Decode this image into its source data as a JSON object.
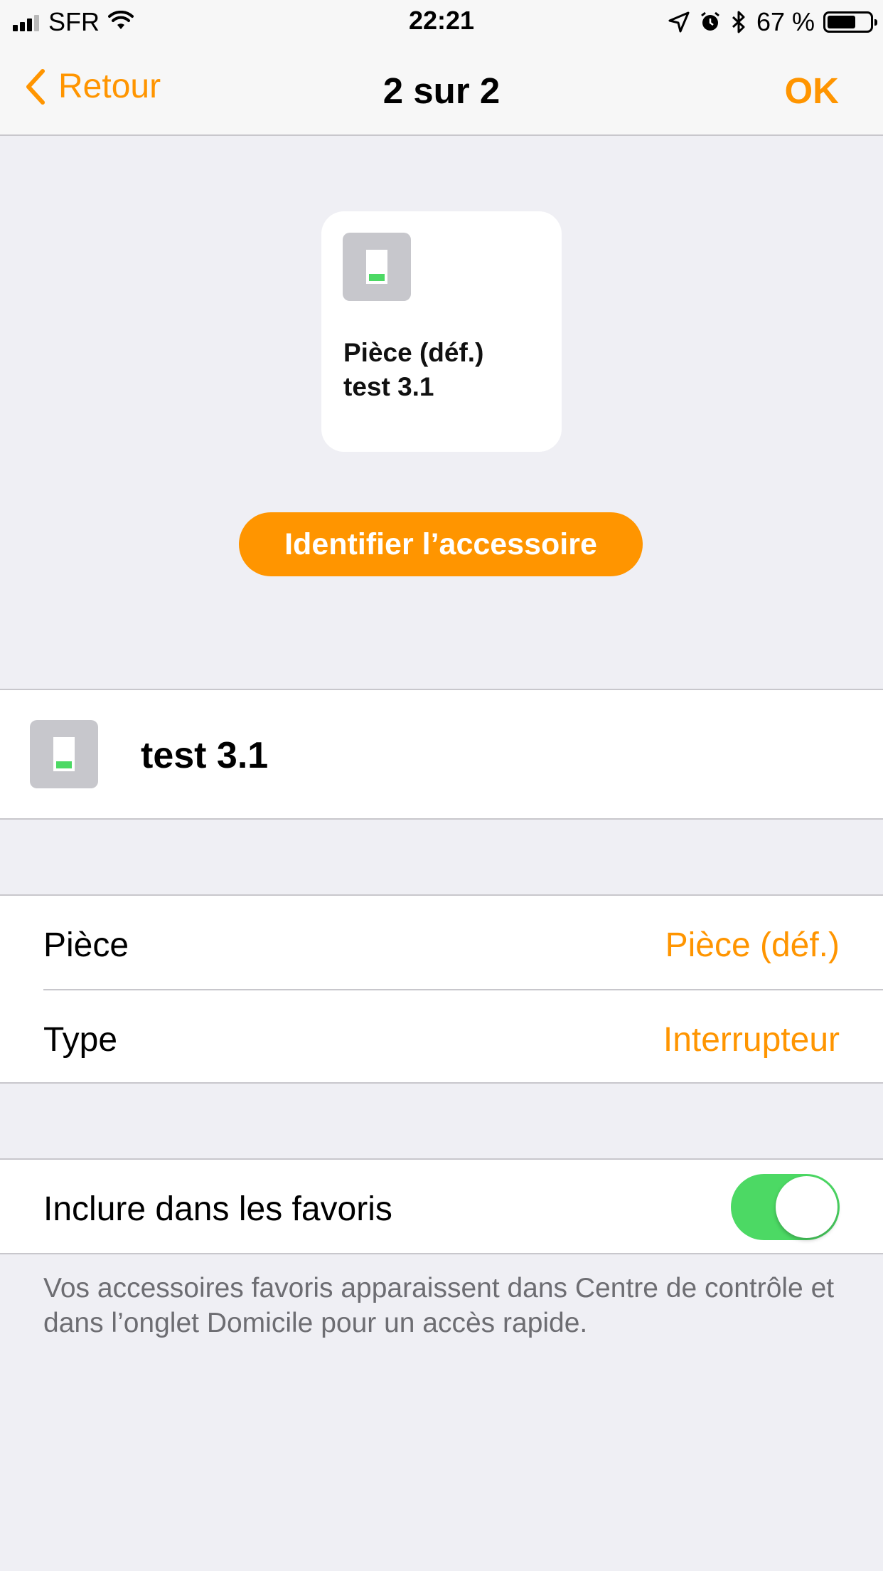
{
  "status_bar": {
    "carrier": "SFR",
    "time": "22:21",
    "battery_text": "67 %",
    "battery_level": 0.67,
    "icons": [
      "signal-icon",
      "wifi-icon",
      "location-icon",
      "alarm-icon",
      "bluetooth-icon",
      "battery-icon"
    ]
  },
  "nav": {
    "back_label": "Retour",
    "title": "2 sur 2",
    "done_label": "OK"
  },
  "tile": {
    "room": "Pièce (déf.)",
    "name": "test 3.1",
    "icon": "switch-icon"
  },
  "identify_button": "Identifier l’accessoire",
  "accessory": {
    "name": "test 3.1",
    "icon": "switch-icon"
  },
  "settings": {
    "room_label": "Pièce",
    "room_value": "Pièce (déf.)",
    "type_label": "Type",
    "type_value": "Interrupteur"
  },
  "favorites": {
    "label": "Inclure dans les favoris",
    "enabled": true,
    "footnote": "Vos accessoires favoris apparaissent dans Centre de contrôle et dans l’onglet Domicile pour un accès rapide."
  },
  "colors": {
    "accent": "#ff9500",
    "toggle_on": "#4cd964",
    "background": "#efeff4"
  }
}
